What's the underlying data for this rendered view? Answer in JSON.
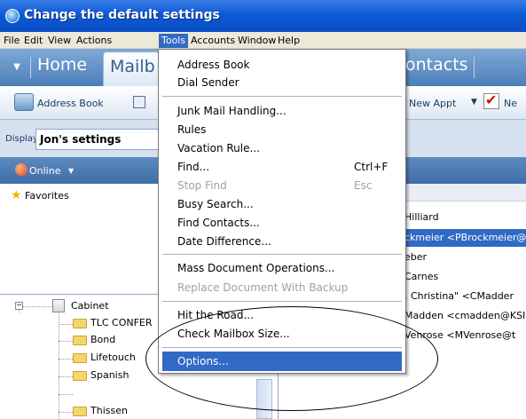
{
  "window": {
    "title": "Change the default settings",
    "icon": "app-globe-icon"
  },
  "menubar": {
    "items": [
      "File",
      "Edit",
      "View",
      "Actions",
      "Tools",
      "Accounts",
      "Window",
      "Help"
    ],
    "active": "Tools"
  },
  "tabs": {
    "dropdown": "▼",
    "home": "Home",
    "mailbox": "Mailb",
    "contacts": "ontacts"
  },
  "toolbar": {
    "address_book": "Address Book",
    "new_appt": "New Appt",
    "new_partial": "Ne",
    "dropdown": "▼",
    "checkmark": "✔"
  },
  "display": {
    "label": "Display",
    "value": "Jon's settings"
  },
  "online": {
    "label": "Online",
    "caret": "▼"
  },
  "favorites": {
    "label": "Favorites",
    "icon": "star-icon"
  },
  "list": {
    "rows": [
      "Hilliard",
      "ckmeier <PBrockmeier@",
      "eber",
      "Carnes",
      ", Christina\" <CMadder",
      "Madden <cmadden@KSI",
      "Venrose <MVenrose@t"
    ],
    "selected_index": 1
  },
  "tree": {
    "root": "Cabinet",
    "toggle": "−",
    "folders": [
      "TLC CONFER",
      "Bond",
      "Lifetouch",
      "Spanish",
      "Thissen"
    ]
  },
  "tools_menu": {
    "groups": [
      [
        {
          "label": "Address Book"
        },
        {
          "label": "Dial Sender"
        }
      ],
      [
        {
          "label": "Junk Mail Handling..."
        },
        {
          "label": "Rules"
        },
        {
          "label": "Vacation Rule..."
        },
        {
          "label": "Find...",
          "shortcut": "Ctrl+F"
        },
        {
          "label": "Stop Find",
          "shortcut": "Esc",
          "disabled": true
        },
        {
          "label": "Busy Search..."
        },
        {
          "label": "Find Contacts..."
        },
        {
          "label": "Date Difference..."
        }
      ],
      [
        {
          "label": "Mass Document Operations..."
        },
        {
          "label": "Replace Document With Backup",
          "disabled": true
        }
      ],
      [
        {
          "label": "Hit the Road..."
        },
        {
          "label": "Check Mailbox Size..."
        }
      ],
      [
        {
          "label": "Options...",
          "highlighted": true
        }
      ]
    ]
  },
  "colors": {
    "selection": "#316ac5",
    "titlebar": "#0c5ad6",
    "menubar": "#ece9d8"
  }
}
